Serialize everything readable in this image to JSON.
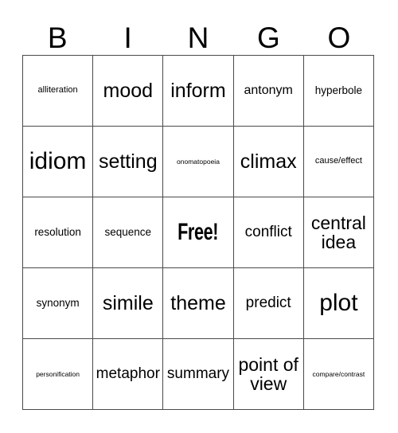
{
  "card": {
    "title": "BINGO",
    "header_letters": [
      "B",
      "I",
      "N",
      "G",
      "O"
    ],
    "columns": 5,
    "rows": 5,
    "free_space": {
      "row": 3,
      "column": 3,
      "label": "Free!"
    },
    "colors": {
      "background": "#ffffff",
      "text": "#000000",
      "border": "#4a4a4a"
    },
    "grid": [
      [
        {
          "label": "alliteration",
          "size": "xs"
        },
        {
          "label": "mood",
          "size": "xxl"
        },
        {
          "label": "inform",
          "size": "xxl"
        },
        {
          "label": "antonym",
          "size": "m"
        },
        {
          "label": "hyperbole",
          "size": "s"
        }
      ],
      [
        {
          "label": "idiom",
          "size": "mega"
        },
        {
          "label": "setting",
          "size": "xxl"
        },
        {
          "label": "onomatopoeia",
          "size": "xxs"
        },
        {
          "label": "climax",
          "size": "xxl"
        },
        {
          "label": "cause/effect",
          "size": "xs"
        }
      ],
      [
        {
          "label": "resolution",
          "size": "s"
        },
        {
          "label": "sequence",
          "size": "s"
        },
        {
          "label": "Free!",
          "size": "free"
        },
        {
          "label": "conflict",
          "size": "l"
        },
        {
          "label": "central idea",
          "size": "xl"
        }
      ],
      [
        {
          "label": "synonym",
          "size": "s"
        },
        {
          "label": "simile",
          "size": "xxl"
        },
        {
          "label": "theme",
          "size": "xxl"
        },
        {
          "label": "predict",
          "size": "l"
        },
        {
          "label": "plot",
          "size": "mega"
        }
      ],
      [
        {
          "label": "personification",
          "size": "xxs"
        },
        {
          "label": "metaphor",
          "size": "l"
        },
        {
          "label": "summary",
          "size": "l"
        },
        {
          "label": "point of view",
          "size": "xl"
        },
        {
          "label": "compare/contrast",
          "size": "xxs"
        }
      ]
    ]
  }
}
